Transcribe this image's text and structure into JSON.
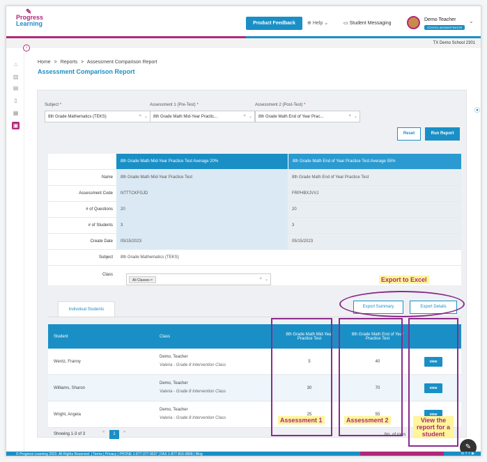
{
  "app": {
    "logo_line1": "Progress",
    "logo_line2": "Learning",
    "feedback_label": "Product Feedback",
    "help_label": "Help",
    "messaging_label": "Student Messaging",
    "user_name": "Demo Teacher",
    "user_role": "SCHOOL ADMINISTRATOR",
    "school": "TX Demo School 2301"
  },
  "breadcrumb": [
    "Home",
    ">",
    "Reports",
    ">",
    "Assessment Comparison Report"
  ],
  "page_title": "Assessment Comparison Report",
  "filters": {
    "subject_label": "Subject",
    "subject_value": "8th Grade Mathematics (TEKS)",
    "a1_label": "Assessment 1 (Pre-Test)",
    "a1_value": "8th Grade Math Mid-Year Practic...",
    "a2_label": "Assessment 2 (Post-Test)",
    "a2_value": "8th Grade Math End of Year Prac...",
    "required": "*",
    "reset_label": "Reset",
    "run_label": "Run Report"
  },
  "comparison": {
    "header_a1": "8th Grade Math Mid-Year Practice Test Average 20%",
    "header_a2": "8th Grade Math End of Year Practice Test Average 55%",
    "rows": [
      {
        "label": "Name",
        "a1": "8th Grade Math Mid-Year Practice Test",
        "a2": "8th Grade Math End of Year Practice Test"
      },
      {
        "label": "Assessment Code",
        "a1": "NTTTCKFGJD",
        "a2": "FRPHBXJVVJ"
      },
      {
        "label": "# of Questions",
        "a1": "20",
        "a2": "20"
      },
      {
        "label": "# of Students",
        "a1": "3",
        "a2": "3"
      },
      {
        "label": "Create Date",
        "a1": "05/15/2023",
        "a2": "05/15/2023"
      }
    ],
    "subject_label": "Subject",
    "subject_value": "8th Grade Mathematics (TEKS)",
    "class_label": "Class",
    "class_chip": "All Classes"
  },
  "tabs": {
    "individual": "Individual Students"
  },
  "export": {
    "summary": "Export Summary",
    "details": "Export Details"
  },
  "students_table": {
    "col_student": "Student",
    "col_class": "Class",
    "col_a1": "8th Grade Math Mid-Year Practice Test",
    "col_a2": "8th Grade Math End of Year Practice Test",
    "view_label": "view",
    "rows": [
      {
        "name": "Wentz, Franny",
        "class1": "Demo, Teacher",
        "class2": "Valeria - Grade 8 Intervention Class",
        "a1": "5",
        "a2": "40"
      },
      {
        "name": "Williams, Sharon",
        "class1": "Demo, Teacher",
        "class2": "Valeria - Grade 8 Intervention Class",
        "a1": "30",
        "a2": "70"
      },
      {
        "name": "Wright, Angela",
        "class1": "Demo, Teacher",
        "class2": "Valeria - Grade 8 Intervention Class",
        "a1": "25",
        "a2": "55"
      }
    ],
    "showing": "Showing 1-3 of 3",
    "page_current": "1",
    "page_prev": "«",
    "page_next": "»",
    "norows": "No. of rows"
  },
  "annotations": {
    "export_excel": "Export to Excel",
    "assessment1": "Assessment 1",
    "assessment2": "Assessment 2",
    "view_report": "View the report for a student"
  },
  "footer": {
    "copyright": "© Progress Learning 2023. All Rights Reserved.",
    "terms": "Terms",
    "privacy": "Privacy",
    "phone": "PHONE 1-877-377-9537",
    "fax": "FAX 1-877-816-0808",
    "blog": "Blog"
  },
  "colors": {
    "brand_blue": "#1a8fc6",
    "brand_pink": "#b0287a",
    "annotation_purple": "#8b2a8b",
    "highlight_yellow": "#fff59a"
  }
}
